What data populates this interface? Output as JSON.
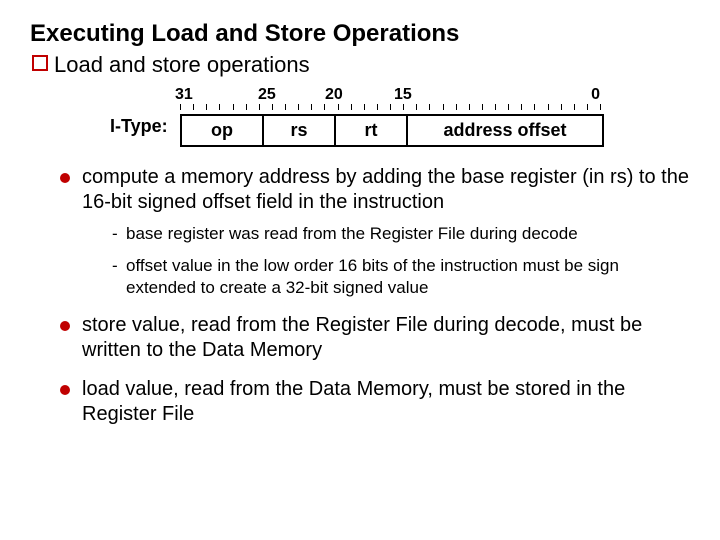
{
  "title": "Executing Load and Store Operations",
  "subhead": "Load and store operations",
  "format": {
    "label": "I-Type:",
    "bits": {
      "n31": "31",
      "n25": "25",
      "n20": "20",
      "n15": "15",
      "n0": "0"
    },
    "fields": {
      "op": "op",
      "rs": "rs",
      "rt": "rt",
      "offset": "address offset"
    },
    "tick_count": 32
  },
  "bullets": {
    "b1": "compute a memory address by adding the base register (in rs) to the 16-bit signed offset field in the instruction",
    "b1a": "base register was read from the Register File during decode",
    "b1b": "offset value in the low order 16 bits of the instruction must be sign extended to create a 32-bit signed value",
    "b2": "store value, read from the Register File during decode, must be written to the Data Memory",
    "b3": "load value, read from the Data Memory, must be stored in the Register File"
  }
}
